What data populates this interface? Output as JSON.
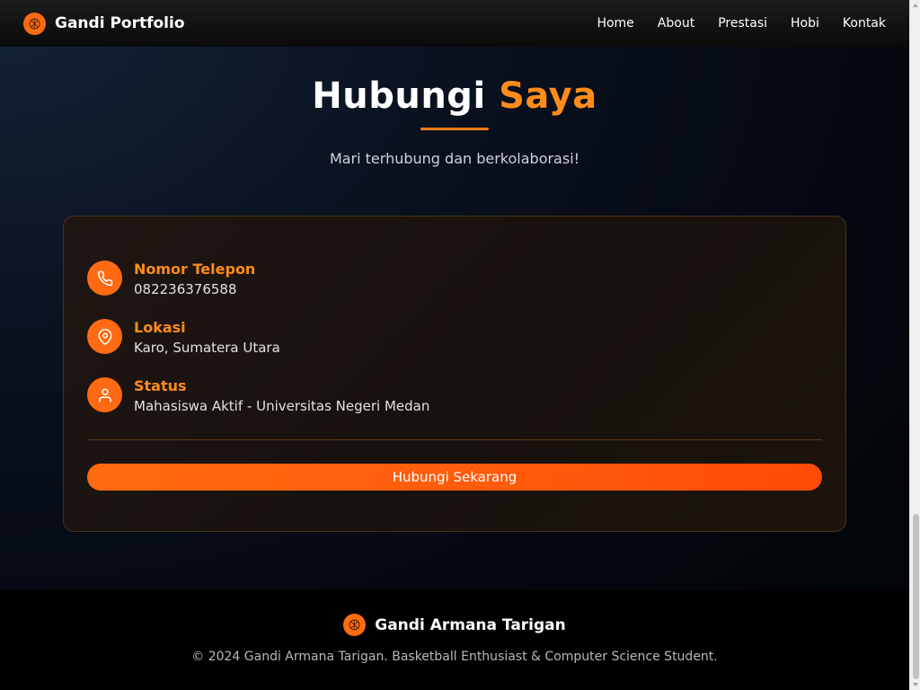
{
  "navbar": {
    "brand": "Gandi Portfolio",
    "logo_icon": "basketball-icon",
    "links": [
      "Home",
      "About",
      "Prestasi",
      "Hobi",
      "Kontak"
    ]
  },
  "contact": {
    "title_main": "Hubungi",
    "title_accent": "Saya",
    "subtitle": "Mari terhubung dan berkolaborasi!",
    "items": [
      {
        "icon": "phone-icon",
        "label": "Nomor Telepon",
        "value": "082236376588"
      },
      {
        "icon": "location-pin-icon",
        "label": "Lokasi",
        "value": "Karo, Sumatera Utara"
      },
      {
        "icon": "user-icon",
        "label": "Status",
        "value": "Mahasiswa Aktif - Universitas Negeri Medan"
      }
    ],
    "cta_label": "Hubungi Sekarang"
  },
  "footer": {
    "name": "Gandi Armana Tarigan",
    "copyright": "© 2024 Gandi Armana Tarigan. Basketball Enthusiast & Computer Science Student."
  },
  "colors": {
    "accent": "#ff8c1a",
    "button": "#ff6a10"
  }
}
